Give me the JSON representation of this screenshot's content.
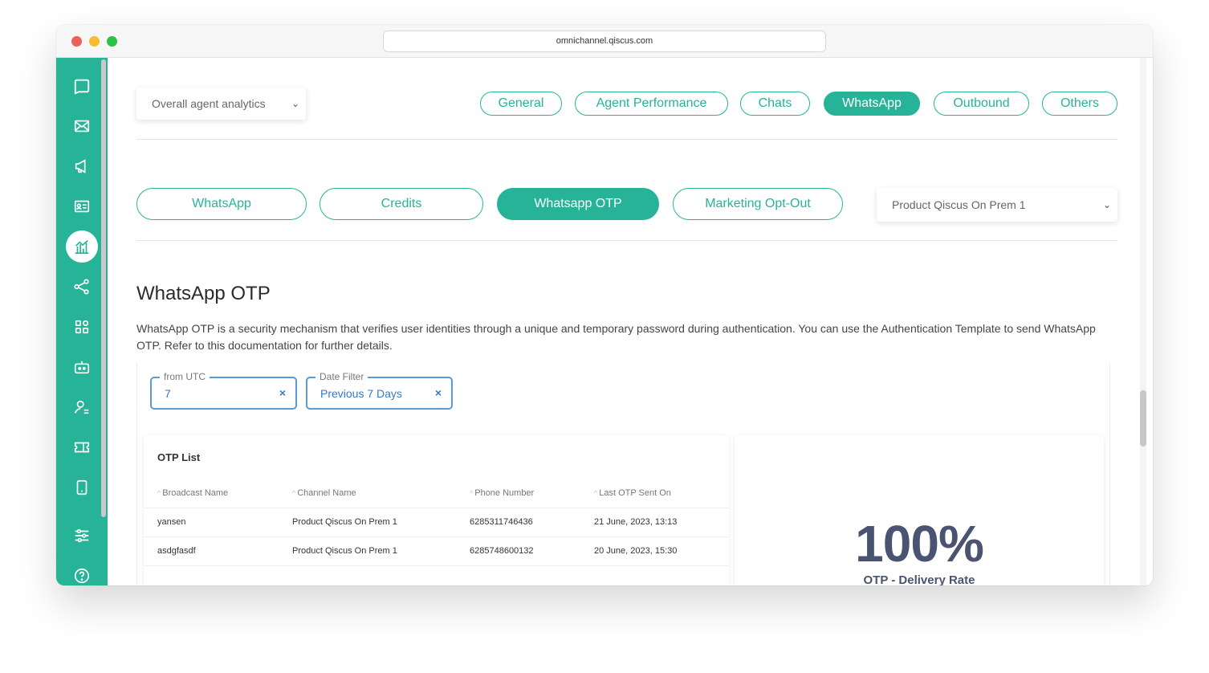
{
  "browser": {
    "url": "omnichannel.qiscus.com"
  },
  "sidebar": {
    "items": [
      {
        "icon": "chat-icon"
      },
      {
        "icon": "mail-icon"
      },
      {
        "icon": "megaphone-icon"
      },
      {
        "icon": "contact-card-icon"
      },
      {
        "icon": "analytics-icon",
        "active": true
      },
      {
        "icon": "integration-icon"
      },
      {
        "icon": "apps-grid-icon"
      },
      {
        "icon": "bot-icon"
      },
      {
        "icon": "agent-icon"
      },
      {
        "icon": "ticket-icon"
      },
      {
        "icon": "mobile-icon"
      },
      {
        "icon": "settings-sliders-icon"
      },
      {
        "icon": "help-icon"
      }
    ]
  },
  "header": {
    "analytics_select": "Overall agent analytics",
    "tabs": [
      "General",
      "Agent Performance",
      "Chats",
      "WhatsApp",
      "Outbound",
      "Others"
    ],
    "active_tab": "WhatsApp"
  },
  "subtabs": {
    "items": [
      "WhatsApp",
      "Credits",
      "Whatsapp OTP",
      "Marketing Opt-Out"
    ],
    "active": "Whatsapp OTP",
    "channel_select": "Product Qiscus On Prem 1"
  },
  "section": {
    "title": "WhatsApp OTP",
    "description": "WhatsApp OTP is a security mechanism that verifies user identities through a unique and temporary password during authentication. You can use the Authentication Template to send WhatsApp OTP. Refer to this documentation for further details."
  },
  "filters": {
    "utc": {
      "label": "from UTC",
      "value": "7",
      "clear": "×"
    },
    "date": {
      "label": "Date Filter",
      "value": "Previous 7 Days",
      "clear": "×"
    }
  },
  "otp_list": {
    "title": "OTP List",
    "columns": [
      "Broadcast Name",
      "Channel Name",
      "Phone Number",
      "Last OTP Sent On"
    ],
    "rows": [
      [
        "yansen",
        "Product Qiscus On Prem 1",
        "6285311746436",
        "21 June, 2023, 13:13"
      ],
      [
        "asdgfasdf",
        "Product Qiscus On Prem 1",
        "6285748600132",
        "20 June, 2023, 15:30"
      ]
    ]
  },
  "delivery": {
    "value": "100%",
    "label": "OTP - Delivery Rate"
  },
  "colors": {
    "accent": "#27b397",
    "filter_blue": "#3a78c2",
    "stat": "#4a5472"
  }
}
